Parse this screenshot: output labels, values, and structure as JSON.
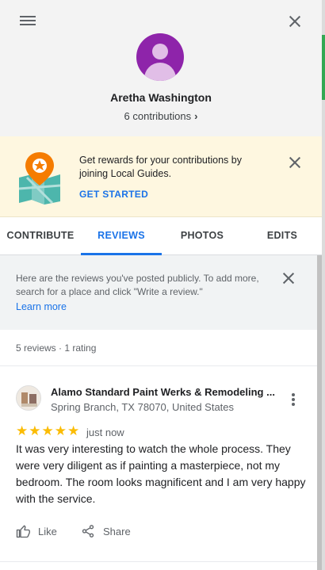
{
  "header": {
    "menu_icon": "hamburger-menu-icon",
    "close_icon": "close-icon",
    "user_name": "Aretha Washington",
    "contributions": "6 contributions",
    "contributions_chevron": "›",
    "avatar_color": "#8e24aa"
  },
  "banner": {
    "text": "Get rewards for your contributions by joining Local Guides.",
    "cta": "GET STARTED",
    "background": "#fef7e0"
  },
  "tabs": [
    {
      "label": "CONTRIBUTE",
      "active": false
    },
    {
      "label": "REVIEWS",
      "active": true
    },
    {
      "label": "PHOTOS",
      "active": false
    },
    {
      "label": "EDITS",
      "active": false
    }
  ],
  "info": {
    "text": "Here are the reviews you've posted publicly. To add more, search for a place and click \"Write a review.\"",
    "link": "Learn more"
  },
  "summary": {
    "count_text": "5 reviews · 1 rating"
  },
  "review": {
    "place_name": "Alamo Standard Paint Werks & Remodeling ...",
    "place_address": "Spring Branch, TX 78070, United States",
    "stars": "★★★★★",
    "rating": 5,
    "time": "just now",
    "body": "It was very interesting to watch the whole process. They were very diligent as if painting a masterpiece, not my bedroom. The room looks magnificent and I am very happy with the service.",
    "like_label": "Like",
    "share_label": "Share"
  },
  "colors": {
    "accent": "#1a73e8",
    "star": "#fbbc04"
  }
}
